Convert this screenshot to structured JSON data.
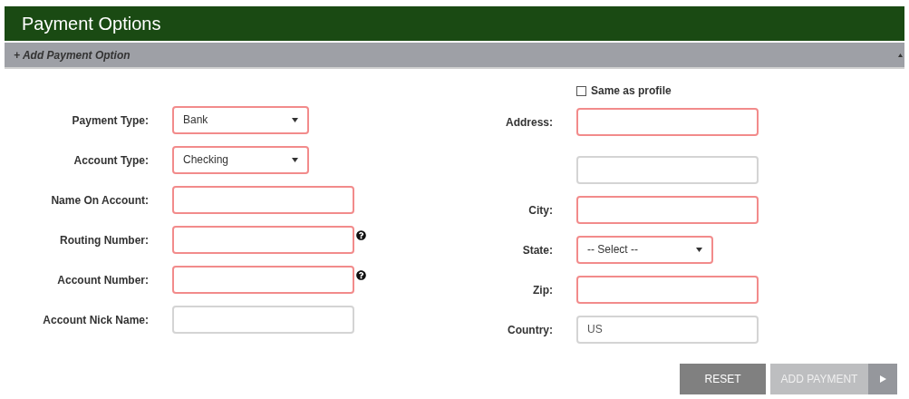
{
  "header": {
    "title": "Payment Options"
  },
  "section_bar": {
    "label": "+ Add Payment Option",
    "expanded": true
  },
  "left_fields": [
    {
      "label": "Payment Type:",
      "kind": "select",
      "value": "Bank",
      "required": true,
      "help": false
    },
    {
      "label": "Account Type:",
      "kind": "select",
      "value": "Checking",
      "required": true,
      "help": false
    },
    {
      "label": "Name On Account:",
      "kind": "text",
      "required": true,
      "help": false
    },
    {
      "label": "Routing Number:",
      "kind": "text",
      "required": true,
      "help": true
    },
    {
      "label": "Account Number:",
      "kind": "text",
      "required": true,
      "help": true
    },
    {
      "label": "Account Nick Name:",
      "kind": "text",
      "required": false,
      "help": false
    }
  ],
  "same_as_profile": {
    "label": "Same as profile",
    "checked": false
  },
  "right_fields": [
    {
      "label": "Address:",
      "kind": "text",
      "required": true
    },
    {
      "kind": "text",
      "required": false
    },
    {
      "label": "City:",
      "kind": "text",
      "required": true
    },
    {
      "label": "State:",
      "kind": "select",
      "value": "-- Select --",
      "required": true
    },
    {
      "label": "Zip:",
      "kind": "text",
      "required": true
    },
    {
      "label": "Country:",
      "kind": "text",
      "value": "US",
      "required": false
    }
  ],
  "buttons": [
    {
      "label": "RESET",
      "kind": "reset",
      "disabled": false
    },
    {
      "label": "ADD PAYMENT",
      "kind": "submit",
      "disabled": true
    }
  ]
}
